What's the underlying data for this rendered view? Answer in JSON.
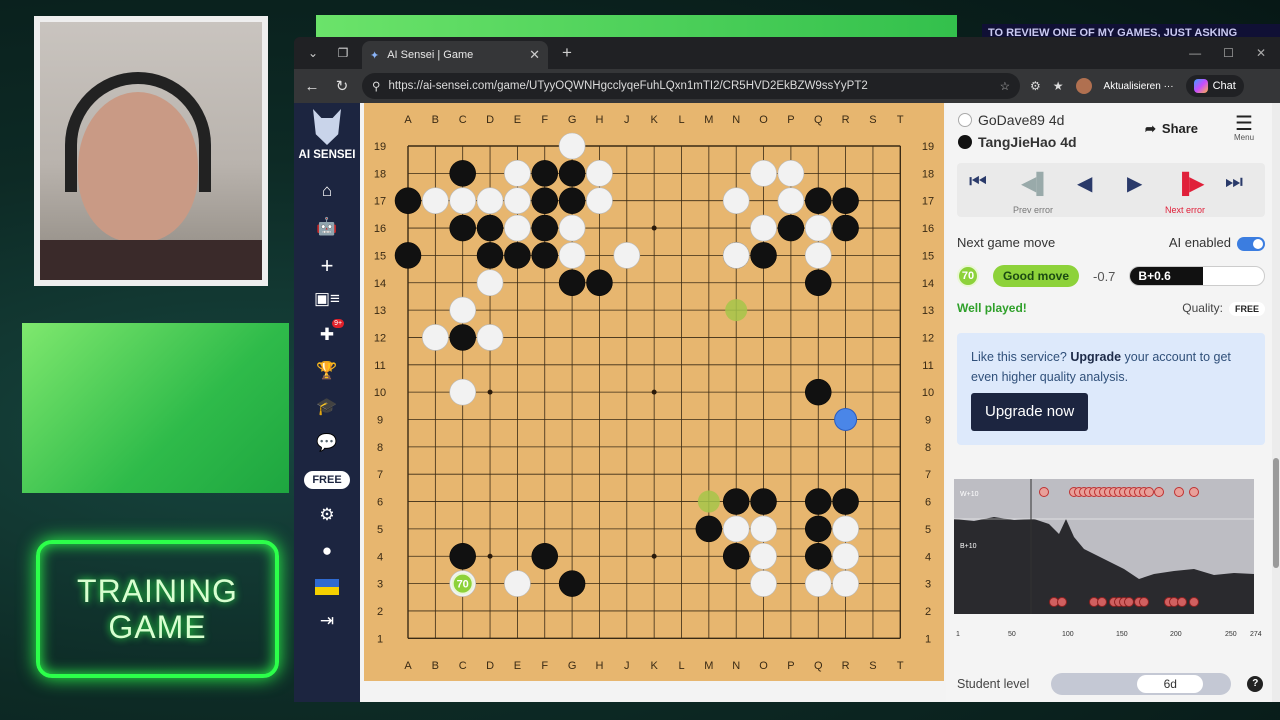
{
  "overlay": {
    "ticker_text": "TO REVIEW ONE OF MY GAMES, JUST ASKING",
    "training_line1": "TRAINING",
    "training_line2": "GAME"
  },
  "browser": {
    "tab_title": "AI Sensei | Game",
    "url": "https://ai-sensei.com/game/UTyyOQWNHgcclyqeFuhLQxn1mTI2/CR5HVD2EkBZW9ssYyPT2",
    "update_label": "Aktualisieren",
    "chat_label": "Chat"
  },
  "sidebar": {
    "brand": "AI SENSEI",
    "badge": "9+",
    "free_label": "FREE"
  },
  "board": {
    "columns": [
      "A",
      "B",
      "C",
      "D",
      "E",
      "F",
      "G",
      "H",
      "J",
      "K",
      "L",
      "M",
      "N",
      "O",
      "P",
      "Q",
      "R",
      "S",
      "T"
    ],
    "rows": [
      "19",
      "18",
      "17",
      "16",
      "15",
      "14",
      "13",
      "12",
      "11",
      "10",
      "9",
      "8",
      "7",
      "6",
      "5",
      "4",
      "3",
      "2",
      "1"
    ],
    "last_move_label": "70",
    "black_stones": [
      "C18",
      "F18",
      "G18",
      "A17",
      "F17",
      "G17",
      "C16",
      "D16",
      "F16",
      "A15",
      "D15",
      "E15",
      "F15",
      "G14",
      "H14",
      "C12",
      "Q10",
      "N15",
      "O15",
      "P16",
      "Q17",
      "R17",
      "R16",
      "Q14",
      "N6",
      "O6",
      "M5",
      "N4",
      "Q6",
      "R6",
      "Q5",
      "Q4",
      "C4",
      "F4",
      "G3"
    ],
    "white_stones": [
      "G19",
      "E18",
      "H18",
      "B17",
      "C17",
      "D17",
      "E17",
      "H17",
      "E16",
      "G16",
      "G15",
      "J15",
      "D14",
      "C13",
      "B12",
      "D12",
      "C10",
      "O18",
      "P18",
      "N17",
      "P17",
      "O16",
      "Q16",
      "N15_",
      "Q15",
      "N5",
      "O5",
      "O4",
      "O3",
      "R5",
      "R4",
      "Q3",
      "R3",
      "E3"
    ],
    "green_hints": [
      "N13",
      "M6"
    ],
    "blue_hint": "R9",
    "star_points": [
      "D16",
      "K16",
      "Q16",
      "D10",
      "K10",
      "Q10",
      "D4",
      "K4",
      "Q4"
    ]
  },
  "panel": {
    "white_player": "GoDave89 4d",
    "black_player": "TangJieHao 4d",
    "share_label": "Share",
    "menu_label": "Menu",
    "prev_error_label": "Prev error",
    "next_error_label": "Next error",
    "next_game_move_label": "Next game move",
    "ai_enabled_label": "AI enabled",
    "move_number": "70",
    "move_quality": "Good move",
    "score_delta": "-0.7",
    "winrate_label": "B+0.6",
    "well_played": "Well played!",
    "quality_label": "Quality:",
    "quality_tier": "FREE",
    "upsell_pre": "Like this service?",
    "upsell_bold": "Upgrade",
    "upsell_post": "your account to get even higher quality analysis.",
    "upgrade_button": "Upgrade now",
    "graph_top_label": "W+10",
    "graph_mid_label": "B+10",
    "graph_x_ticks": [
      "1",
      "50",
      "100",
      "150",
      "200",
      "250",
      "274"
    ],
    "student_level_label": "Student level",
    "student_level_value": "6d",
    "help_label": "?"
  },
  "colors": {
    "board": "#e7b66f",
    "nav_bg": "#1c2540",
    "good_move": "#8dd23a",
    "error_red": "#e0203a",
    "neon_green": "#2cff4a"
  }
}
